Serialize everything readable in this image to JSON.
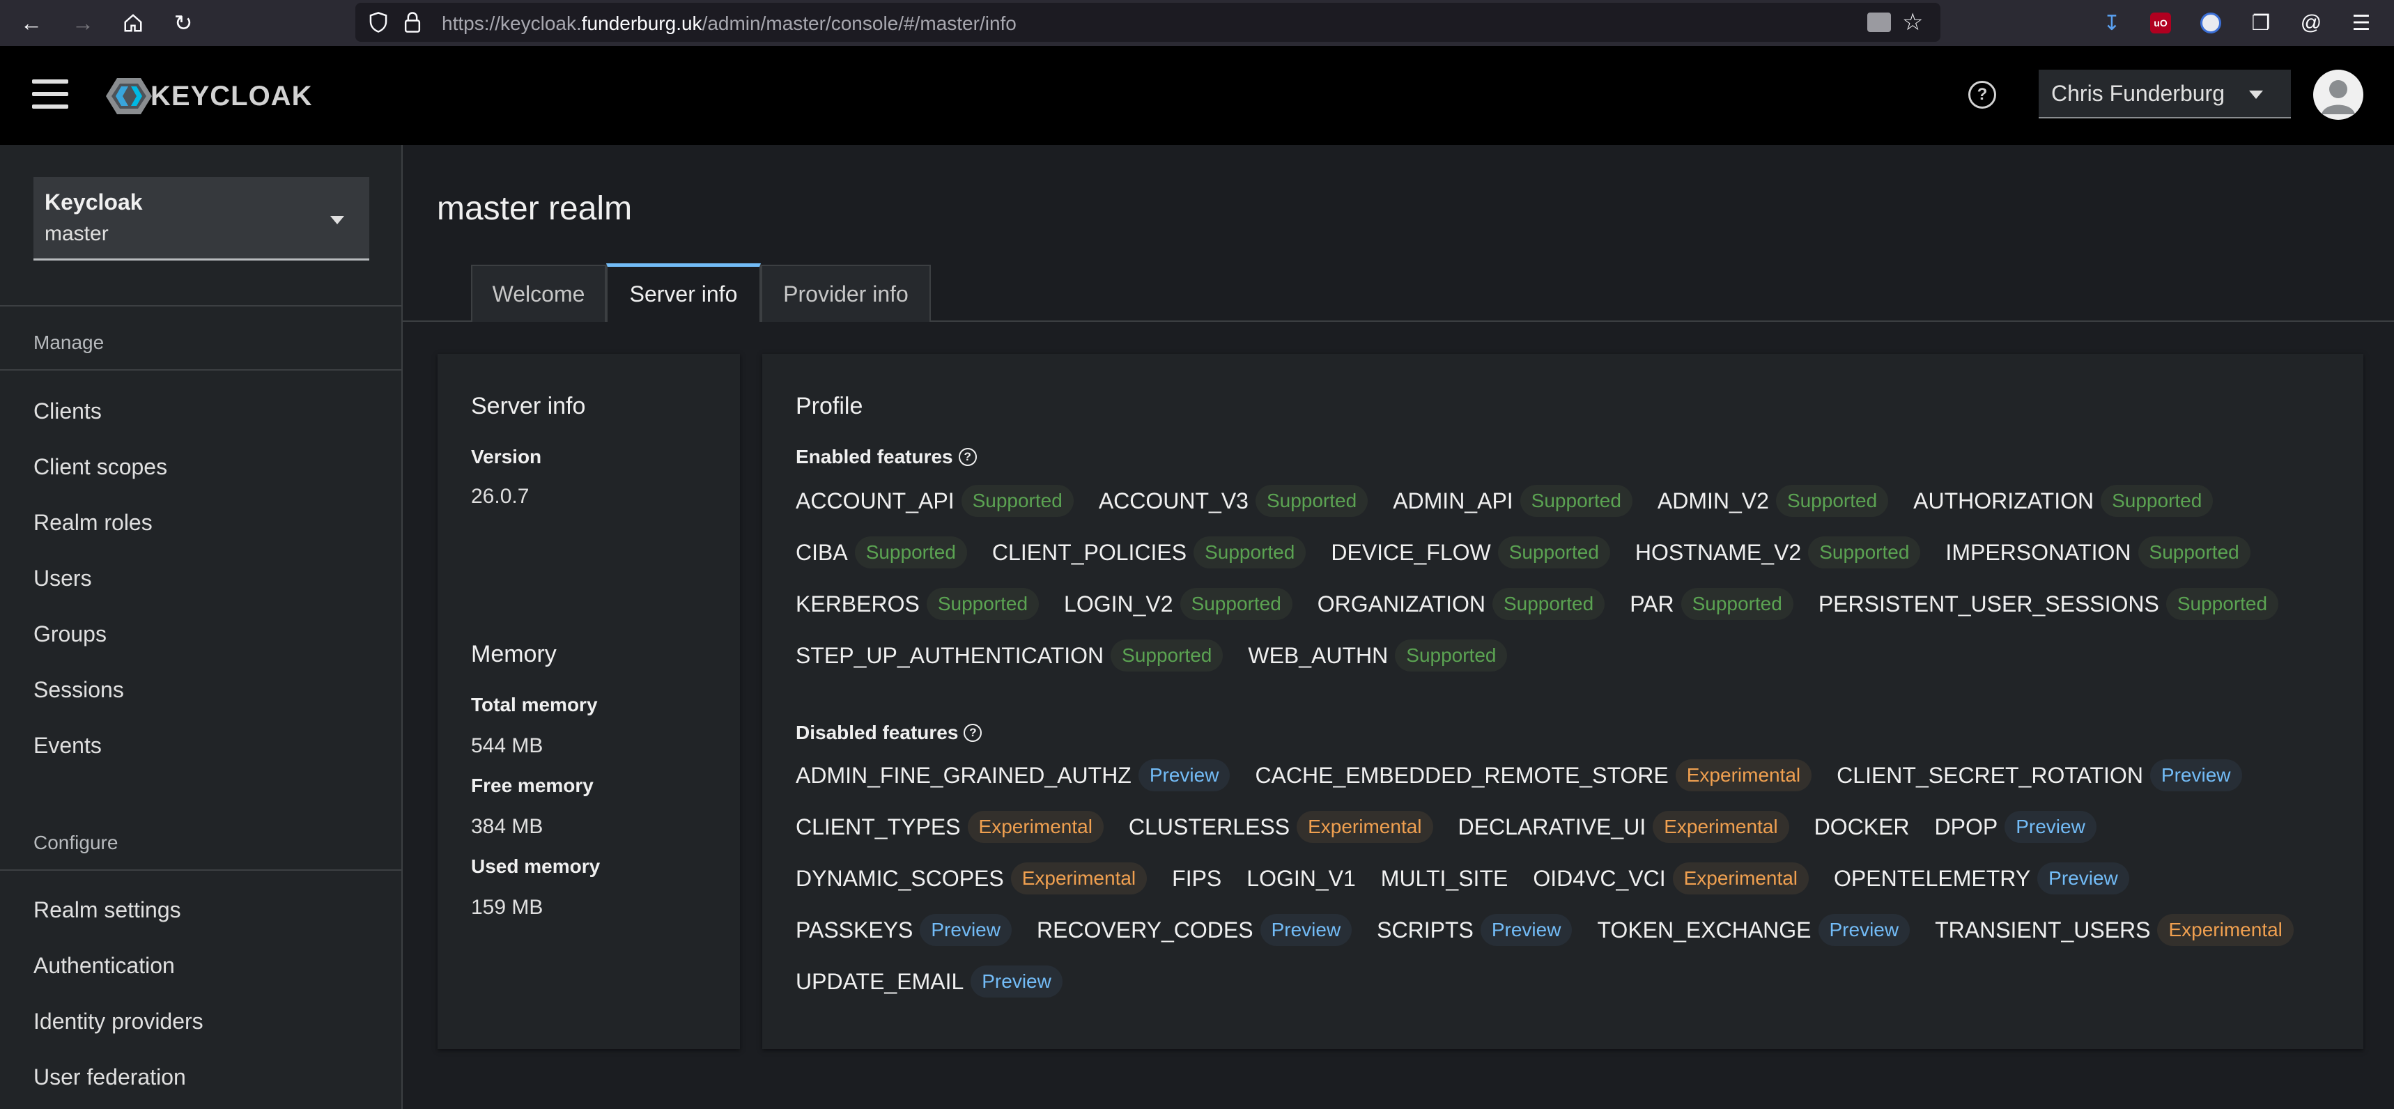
{
  "browser": {
    "url_prefix": "https://keycloak.",
    "url_domain": "funderburg.uk",
    "url_path": "/admin/master/console/#/master/info"
  },
  "header": {
    "logo_text": "KEYCLOAK",
    "user_name": "Chris Funderburg"
  },
  "sidebar": {
    "realm_select": {
      "title": "Keycloak",
      "realm": "master"
    },
    "manage_label": "Manage",
    "manage_items": [
      "Clients",
      "Client scopes",
      "Realm roles",
      "Users",
      "Groups",
      "Sessions",
      "Events"
    ],
    "configure_label": "Configure",
    "configure_items": [
      "Realm settings",
      "Authentication",
      "Identity providers",
      "User federation"
    ]
  },
  "main": {
    "title": "master realm",
    "tabs": [
      "Welcome",
      "Server info",
      "Provider info"
    ],
    "active_tab": "Server info"
  },
  "server_info": {
    "title": "Server info",
    "version_label": "Version",
    "version": "26.0.7",
    "memory_title": "Memory",
    "total_label": "Total memory",
    "total": "544 MB",
    "free_label": "Free memory",
    "free": "384 MB",
    "used_label": "Used memory",
    "used": "159 MB"
  },
  "profile": {
    "title": "Profile",
    "enabled_label": "Enabled features",
    "disabled_label": "Disabled features",
    "enabled_rows": [
      [
        [
          "ACCOUNT_API",
          "Supported"
        ],
        [
          "ACCOUNT_V3",
          "Supported"
        ],
        [
          "ADMIN_API",
          "Supported"
        ],
        [
          "ADMIN_V2",
          "Supported"
        ],
        [
          "AUTHORIZATION",
          "Supported"
        ]
      ],
      [
        [
          "CIBA",
          "Supported"
        ],
        [
          "CLIENT_POLICIES",
          "Supported"
        ],
        [
          "DEVICE_FLOW",
          "Supported"
        ],
        [
          "HOSTNAME_V2",
          "Supported"
        ],
        [
          "IMPERSONATION",
          "Supported"
        ]
      ],
      [
        [
          "KERBEROS",
          "Supported"
        ],
        [
          "LOGIN_V2",
          "Supported"
        ],
        [
          "ORGANIZATION",
          "Supported"
        ],
        [
          "PAR",
          "Supported"
        ],
        [
          "PERSISTENT_USER_SESSIONS",
          "Supported"
        ]
      ],
      [
        [
          "STEP_UP_AUTHENTICATION",
          "Supported"
        ],
        [
          "WEB_AUTHN",
          "Supported"
        ]
      ]
    ],
    "disabled_rows": [
      [
        [
          "ADMIN_FINE_GRAINED_AUTHZ",
          "Preview"
        ],
        [
          "CACHE_EMBEDDED_REMOTE_STORE",
          "Experimental"
        ],
        [
          "CLIENT_SECRET_ROTATION",
          "Preview"
        ]
      ],
      [
        [
          "CLIENT_TYPES",
          "Experimental"
        ],
        [
          "CLUSTERLESS",
          "Experimental"
        ],
        [
          "DECLARATIVE_UI",
          "Experimental"
        ],
        [
          "DOCKER",
          ""
        ],
        [
          "DPOP",
          "Preview"
        ]
      ],
      [
        [
          "DYNAMIC_SCOPES",
          "Experimental"
        ],
        [
          "FIPS",
          ""
        ],
        [
          "LOGIN_V1",
          ""
        ],
        [
          "MULTI_SITE",
          ""
        ],
        [
          "OID4VC_VCI",
          "Experimental"
        ],
        [
          "OPENTELEMETRY",
          "Preview"
        ]
      ],
      [
        [
          "PASSKEYS",
          "Preview"
        ],
        [
          "RECOVERY_CODES",
          "Preview"
        ],
        [
          "SCRIPTS",
          "Preview"
        ],
        [
          "TOKEN_EXCHANGE",
          "Preview"
        ],
        [
          "TRANSIENT_USERS",
          "Experimental"
        ]
      ],
      [
        [
          "UPDATE_EMAIL",
          "Preview"
        ]
      ]
    ]
  },
  "colors": {
    "supported": "#5ba352",
    "preview": "#73bcf7",
    "experimental": "#f0a050",
    "active_tab_accent": "#73bcf7"
  }
}
